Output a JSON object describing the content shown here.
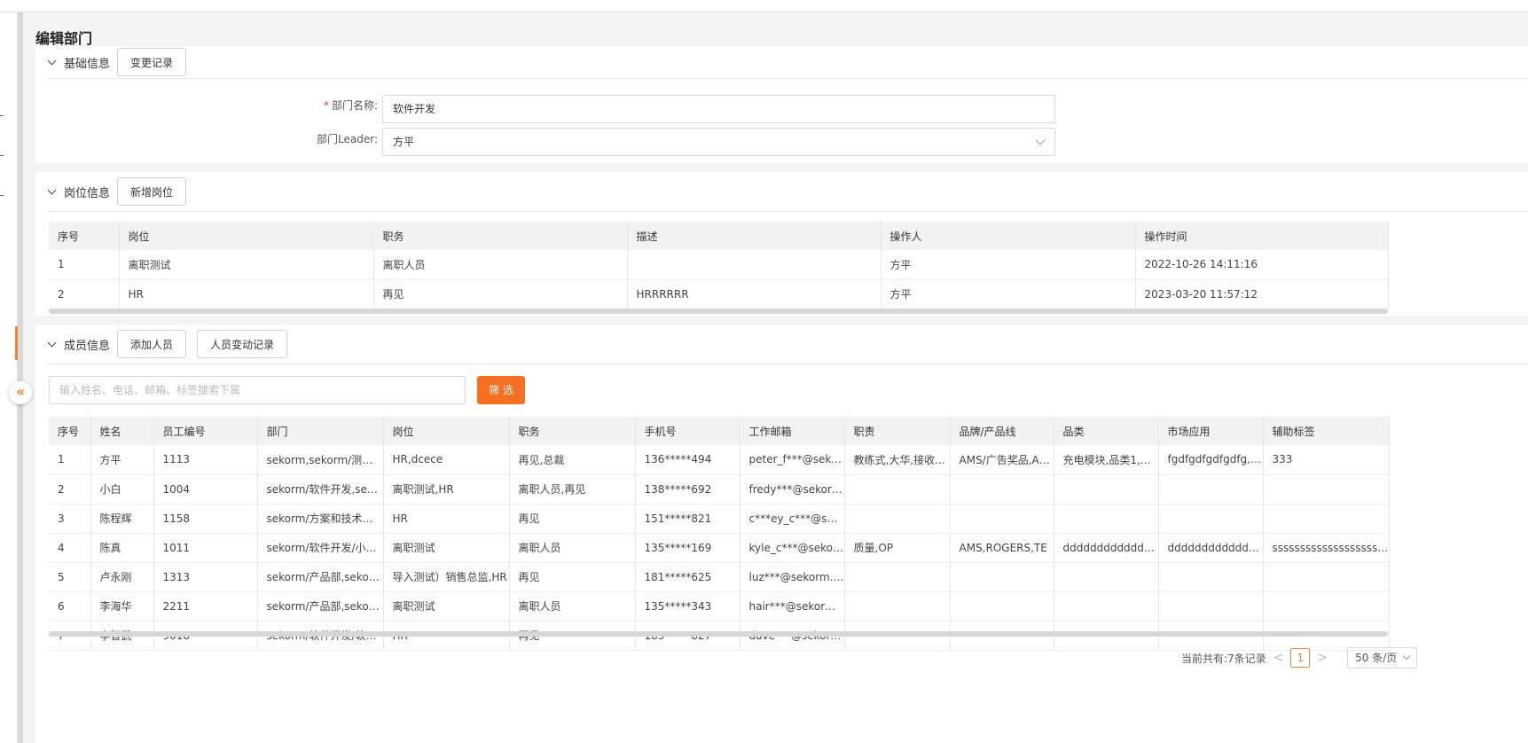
{
  "page": {
    "title": "编辑部门"
  },
  "basic": {
    "title": "基础信息",
    "change_log_btn": "变更记录",
    "dept_name_label": "部门名称:",
    "dept_name_value": "软件开发",
    "leader_label": "部门Leader:",
    "leader_value": "方平"
  },
  "positions": {
    "title": "岗位信息",
    "add_btn": "新增岗位",
    "headers": [
      "序号",
      "岗位",
      "职务",
      "描述",
      "操作人",
      "操作时间"
    ],
    "rows": [
      [
        "1",
        "离职测试",
        "离职人员",
        "",
        "方平",
        "2022-10-26 14:11:16"
      ],
      [
        "2",
        "HR",
        "再见",
        "HRRRRRR",
        "方平",
        "2023-03-20 11:57:12"
      ]
    ]
  },
  "members": {
    "title": "成员信息",
    "add_btn": "添加人员",
    "history_btn": "人员变动记录",
    "search_placeholder": "输入姓名、电话、邮箱、标签搜索下属",
    "filter_btn": "筛 选",
    "headers": [
      "序号",
      "姓名",
      "员工编号",
      "部门",
      "岗位",
      "职务",
      "手机号",
      "工作邮箱",
      "职责",
      "品牌/产品线",
      "品类",
      "市场应用",
      "辅助标签"
    ],
    "rows": [
      [
        "1",
        "方平",
        "1113",
        "sekorm,sekorm/测试部,...",
        "HR,dcece",
        "再见,总裁",
        "136*****494",
        "peter_f***@sekor...",
        "教练式,大华,接收...",
        "AMS/广告奖品,AM...",
        "充电模块,品类1,挖...",
        "fgdfgdfgdfgdfg,IC,...",
        "333"
      ],
      [
        "2",
        "小白",
        "1004",
        "sekorm/软件开发,sekor...",
        "离职测试,HR",
        "离职人员,再见",
        "138*****692",
        "fredy***@sekorm....",
        "",
        "",
        "",
        "",
        ""
      ],
      [
        "3",
        "陈程辉",
        "1158",
        "sekorm/方案和技术中...",
        "HR",
        "再见",
        "151*****821",
        "c***ey_c***@sekor...",
        "",
        "",
        "",
        "",
        ""
      ],
      [
        "4",
        "陈真",
        "1011",
        "sekorm/软件开发/小白...",
        "离职测试",
        "离职人员",
        "135*****169",
        "kyle_c***@sekorm....",
        "质量,OP",
        "AMS,ROGERS,TE",
        "dddddddddddddd...",
        "dddddddddddddd...",
        "ssssssssssssssssssssss..."
      ],
      [
        "5",
        "卢永刚",
        "1313",
        "sekorm/产品部,sekorm/...",
        "导入测试）销售总监,HR",
        "再见",
        "181*****625",
        "luz***@sekorm.com",
        "",
        "",
        "",
        "",
        ""
      ],
      [
        "6",
        "李海华",
        "2211",
        "sekorm/产品部,sekorm/...",
        "离职测试",
        "离职人员",
        "135*****343",
        "hair***@sekorm.c...",
        "",
        "",
        "",
        "",
        ""
      ],
      [
        "7",
        "李智武",
        "9018",
        "sekorm/软件开发/软件...",
        "HR",
        "再见",
        "183*****827",
        "dave***@sekorm.c...",
        "",
        "",
        "",
        "",
        ""
      ]
    ]
  },
  "pagination": {
    "total_text": "当前共有:7条记录",
    "prev": "<",
    "current_page": "1",
    "next": ">",
    "page_size": "50 条/页"
  },
  "sidebar": {
    "collapse_icon": "«"
  }
}
